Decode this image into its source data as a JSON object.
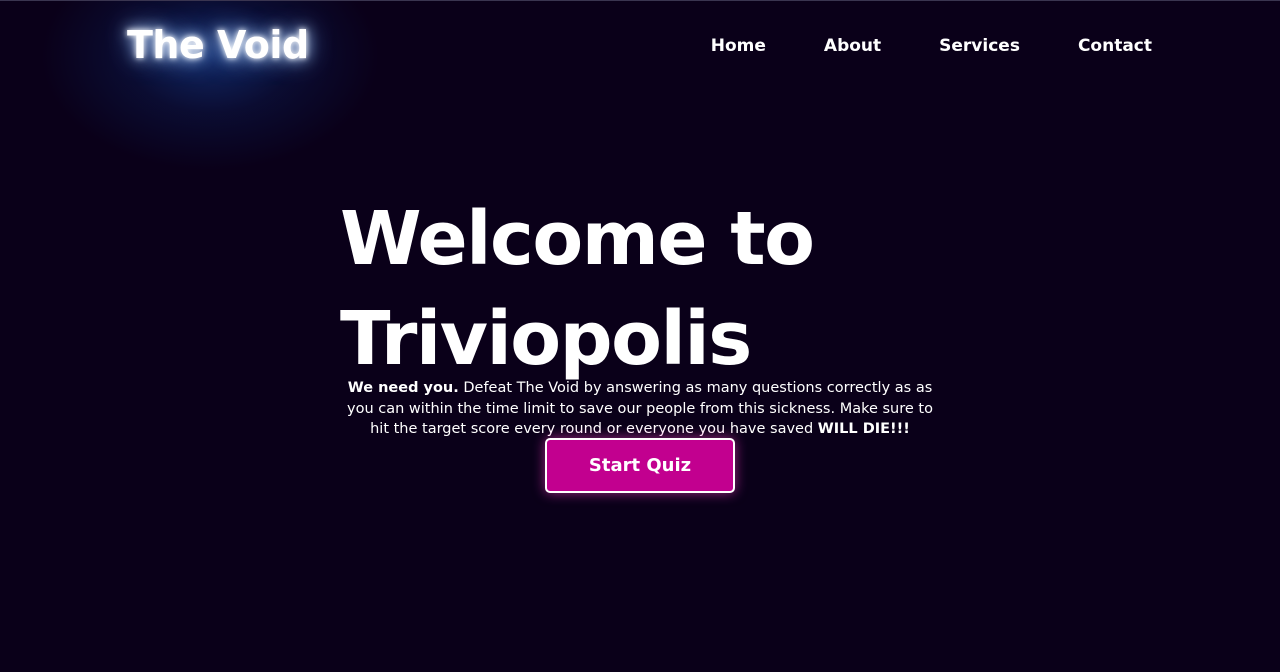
{
  "header": {
    "logo": "The Void",
    "nav": [
      "Home",
      "About",
      "Services",
      "Contact"
    ]
  },
  "hero": {
    "title_line1": "Welcome to",
    "title_line2": "Triviopolis",
    "intro_bold": "We need you.",
    "intro_body": " Defeat The Void by answering as many questions correctly as as you can within the time limit to save our people from this sickness. Make sure to hit the target score every round or everyone you have saved ",
    "intro_warning": "WILL DIE!!!",
    "button_label": "Start Quiz"
  },
  "colors": {
    "background": "#0a0019",
    "button": "#c2008f",
    "logo_glow": "#6ea8ff"
  }
}
